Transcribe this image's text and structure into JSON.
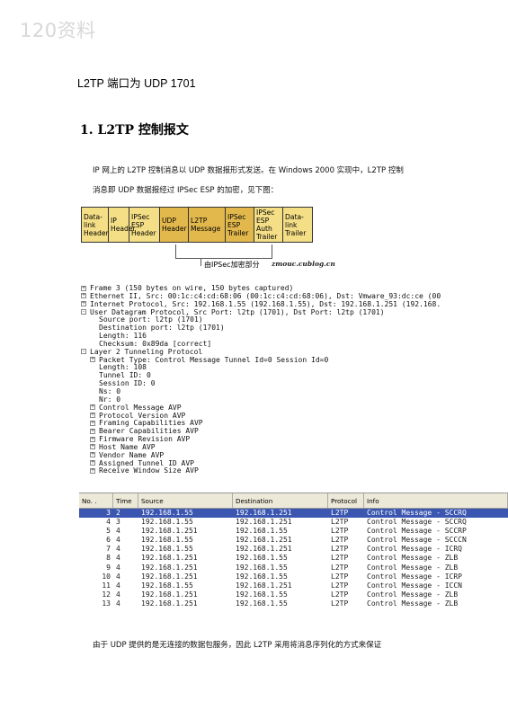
{
  "watermark": "120资料",
  "subtitle": "L2TP 端口为 UDP 1701",
  "heading": "1. L2TP 控制报文",
  "paragraph": {
    "line1": "IP 网上的 L2TP 控制消息以 UDP 数据报形式发送。在 Windows 2000 实现中，L2TP 控制",
    "line2": "消息即 UDP 数据报经过 IPSec ESP 的加密，见下图："
  },
  "diagram": {
    "boxes": [
      {
        "label": "Data-\nlink\nHeader",
        "encrypted": false
      },
      {
        "label": "IP\nHeader",
        "encrypted": false
      },
      {
        "label": "IPSec\nESP\nHeader",
        "encrypted": false
      },
      {
        "label": "UDP\nHeader",
        "encrypted": true
      },
      {
        "label": "L2TP\nMessage",
        "encrypted": true
      },
      {
        "label": "IPSec\nESP\nTrailer",
        "encrypted": true
      },
      {
        "label": "IPSec\nESP\nAuth\nTrailer",
        "encrypted": false
      },
      {
        "label": "Data-\nlink\nTrailer",
        "encrypted": false
      }
    ],
    "bracket_label": "由IPSec加密部分",
    "blog_mark": "zmouc.cublog.cn"
  },
  "tree": [
    {
      "indent": 0,
      "box": "+",
      "text": "Frame 3 (150 bytes on wire, 150 bytes captured)"
    },
    {
      "indent": 0,
      "box": "+",
      "text": "Ethernet II, Src: 00:1c:c4:cd:68:06 (00:1c:c4:cd:68:06), Dst: Vmware_93:dc:ce (00"
    },
    {
      "indent": 0,
      "box": "+",
      "text": "Internet Protocol, Src: 192.168.1.55 (192.168.1.55), Dst: 192.168.1.251 (192.168."
    },
    {
      "indent": 0,
      "box": "-",
      "text": "User Datagram Protocol, Src Port: l2tp (1701), Dst Port: l2tp (1701)"
    },
    {
      "indent": 1,
      "box": "",
      "text": "Source port: l2tp (1701)"
    },
    {
      "indent": 1,
      "box": "",
      "text": "Destination port: l2tp (1701)"
    },
    {
      "indent": 1,
      "box": "",
      "text": "Length: 116"
    },
    {
      "indent": 1,
      "box": "",
      "text": "Checksum: 0x89da [correct]"
    },
    {
      "indent": 0,
      "box": "-",
      "text": "Layer 2 Tunneling Protocol"
    },
    {
      "indent": 1,
      "box": "+",
      "text": "Packet Type: Control Message Tunnel Id=0 Session Id=0"
    },
    {
      "indent": 1,
      "box": "",
      "text": "Length: 108"
    },
    {
      "indent": 1,
      "box": "",
      "text": "Tunnel ID: 0"
    },
    {
      "indent": 1,
      "box": "",
      "text": "Session ID: 0"
    },
    {
      "indent": 1,
      "box": "",
      "text": "Ns: 0"
    },
    {
      "indent": 1,
      "box": "",
      "text": "Nr: 0"
    },
    {
      "indent": 1,
      "box": "+",
      "text": "Control Message AVP"
    },
    {
      "indent": 1,
      "box": "+",
      "text": "Protocol Version AVP"
    },
    {
      "indent": 1,
      "box": "+",
      "text": "Framing Capabilities AVP"
    },
    {
      "indent": 1,
      "box": "+",
      "text": "Bearer Capabilities AVP"
    },
    {
      "indent": 1,
      "box": "+",
      "text": "Firmware Revision AVP"
    },
    {
      "indent": 1,
      "box": "+",
      "text": "Host Name AVP"
    },
    {
      "indent": 1,
      "box": "+",
      "text": "Vendor Name AVP"
    },
    {
      "indent": 1,
      "box": "+",
      "text": "Assigned Tunnel ID AVP"
    },
    {
      "indent": 1,
      "box": "+",
      "text": "Receive Window Size AVP"
    }
  ],
  "packet_list": {
    "columns": [
      "No. .",
      "Time",
      "Source",
      "Destination",
      "Protocol",
      "Info"
    ],
    "rows": [
      {
        "no": "3",
        "time": "2",
        "src": "192.168.1.55",
        "dst": "192.168.1.251",
        "proto": "L2TP",
        "info": "Control Message - SCCRQ",
        "selected": true
      },
      {
        "no": "4",
        "time": "3",
        "src": "192.168.1.55",
        "dst": "192.168.1.251",
        "proto": "L2TP",
        "info": "Control Message - SCCRQ",
        "selected": false
      },
      {
        "no": "5",
        "time": "4",
        "src": "192.168.1.251",
        "dst": "192.168.1.55",
        "proto": "L2TP",
        "info": "Control Message - SCCRP",
        "selected": false
      },
      {
        "no": "6",
        "time": "4",
        "src": "192.168.1.55",
        "dst": "192.168.1.251",
        "proto": "L2TP",
        "info": "Control Message - SCCCN",
        "selected": false
      },
      {
        "no": "7",
        "time": "4",
        "src": "192.168.1.55",
        "dst": "192.168.1.251",
        "proto": "L2TP",
        "info": "Control Message - ICRQ",
        "selected": false
      },
      {
        "no": "8",
        "time": "4",
        "src": "192.168.1.251",
        "dst": "192.168.1.55",
        "proto": "L2TP",
        "info": "Control Message - ZLB",
        "selected": false
      },
      {
        "no": "9",
        "time": "4",
        "src": "192.168.1.251",
        "dst": "192.168.1.55",
        "proto": "L2TP",
        "info": "Control Message - ZLB",
        "selected": false
      },
      {
        "no": "10",
        "time": "4",
        "src": "192.168.1.251",
        "dst": "192.168.1.55",
        "proto": "L2TP",
        "info": "Control Message - ICRP",
        "selected": false
      },
      {
        "no": "11",
        "time": "4",
        "src": "192.168.1.55",
        "dst": "192.168.1.251",
        "proto": "L2TP",
        "info": "Control Message - ICCN",
        "selected": false
      },
      {
        "no": "12",
        "time": "4",
        "src": "192.168.1.251",
        "dst": "192.168.1.55",
        "proto": "L2TP",
        "info": "Control Message - ZLB",
        "selected": false
      },
      {
        "no": "13",
        "time": "4",
        "src": "192.168.1.251",
        "dst": "192.168.1.55",
        "proto": "L2TP",
        "info": "Control Message - ZLB",
        "selected": false
      }
    ]
  },
  "bottom_text": "由于 UDP 提供的是无连接的数据包服务，因此 L2TP 采用将消息序列化的方式来保证"
}
